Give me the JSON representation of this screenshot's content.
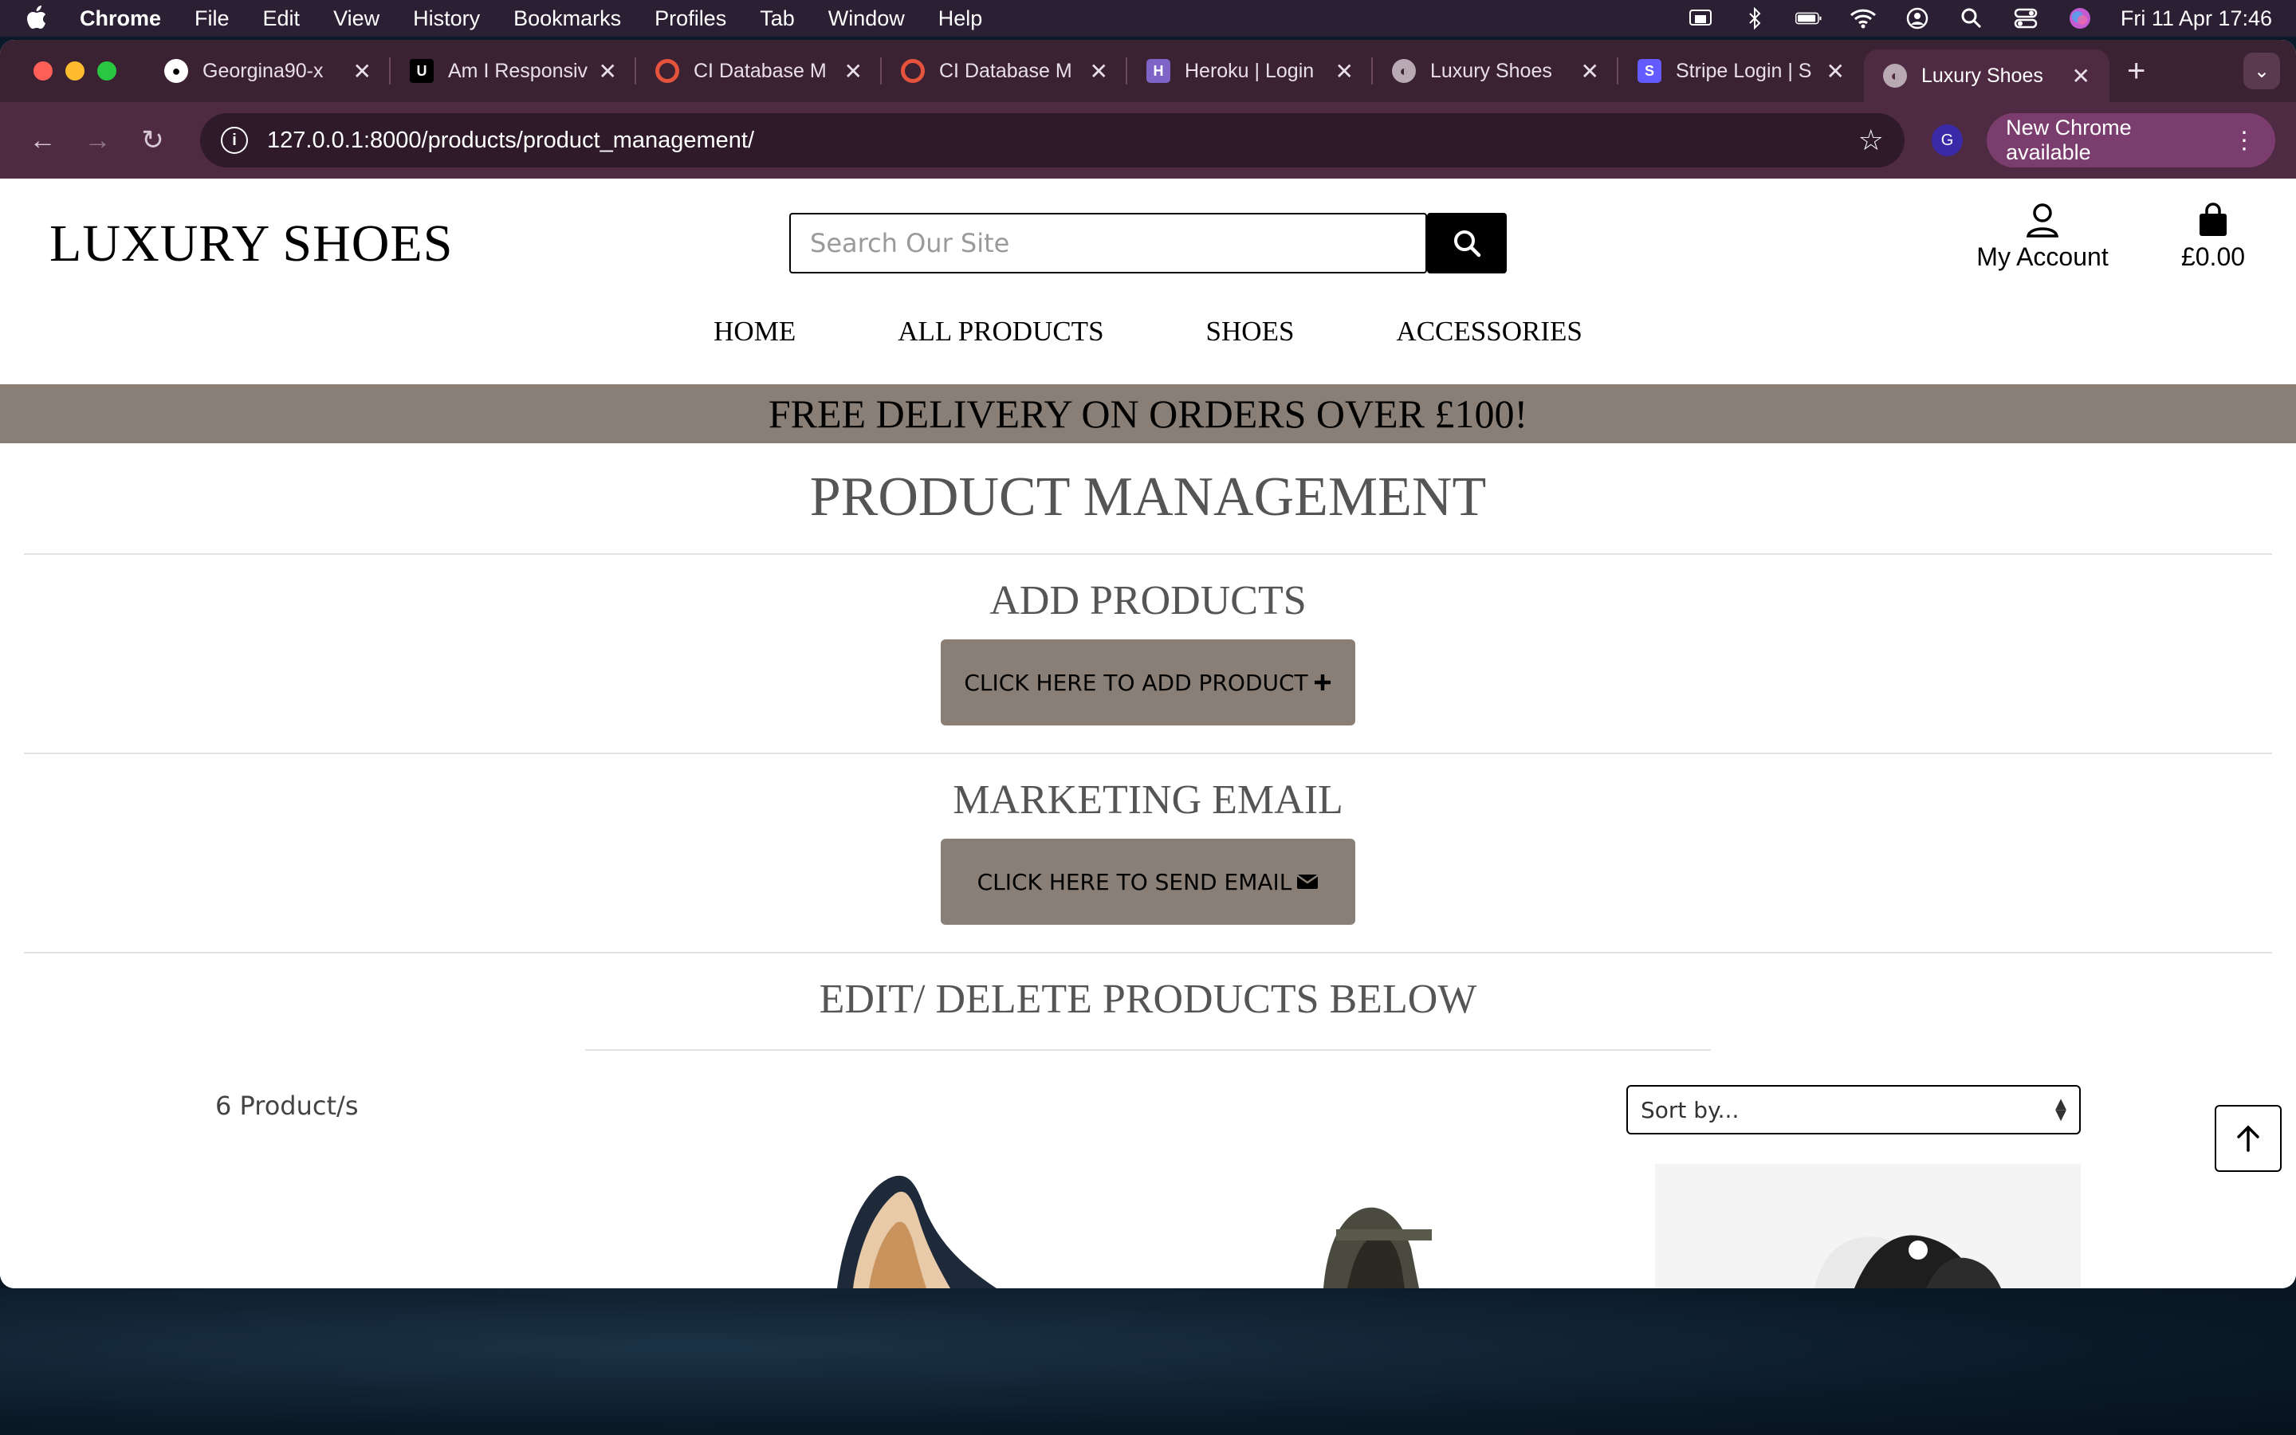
{
  "menubar": {
    "app": "Chrome",
    "items": [
      "File",
      "Edit",
      "View",
      "History",
      "Bookmarks",
      "Profiles",
      "Tab",
      "Window",
      "Help"
    ],
    "clock": "Fri 11 Apr  17:46"
  },
  "tabs": [
    {
      "title": "Georgina90-x",
      "icon": "github-icon"
    },
    {
      "title": "Am I Responsive",
      "icon": "amiresponsive-icon"
    },
    {
      "title": "CI Database M",
      "icon": "ci-icon"
    },
    {
      "title": "CI Database M",
      "icon": "ci-icon"
    },
    {
      "title": "Heroku | Login",
      "icon": "heroku-icon"
    },
    {
      "title": "Luxury Shoes",
      "icon": "globe-icon"
    },
    {
      "title": "Stripe Login | S",
      "icon": "stripe-icon"
    },
    {
      "title": "Luxury Shoes",
      "icon": "globe-icon",
      "active": true
    }
  ],
  "toolbar": {
    "url": "127.0.0.1:8000/products/product_management/",
    "profile_initial": "G",
    "update_label": "New Chrome available"
  },
  "site": {
    "logo": "LUXURY SHOES",
    "search_placeholder": "Search Our Site",
    "account_label": "My Account",
    "bag_total": "£0.00",
    "nav": [
      "HOME",
      "ALL PRODUCTS",
      "SHOES",
      "ACCESSORIES"
    ],
    "banner": "FREE DELIVERY ON ORDERS OVER £100!"
  },
  "main": {
    "title": "PRODUCT MANAGEMENT",
    "add_heading": "ADD PRODUCTS",
    "add_button": "CLICK HERE TO ADD PRODUCT",
    "email_heading": "MARKETING EMAIL",
    "email_button": "CLICK HERE TO SEND EMAIL",
    "edit_heading": "EDIT/ DELETE PRODUCTS BELOW",
    "count": "6 Product/s",
    "sort_value": "Sort by..."
  },
  "colors": {
    "accent_taupe": "#8a7f76",
    "chrome_toolbar": "#4e2b42",
    "chrome_tabstrip": "#3b2232"
  }
}
